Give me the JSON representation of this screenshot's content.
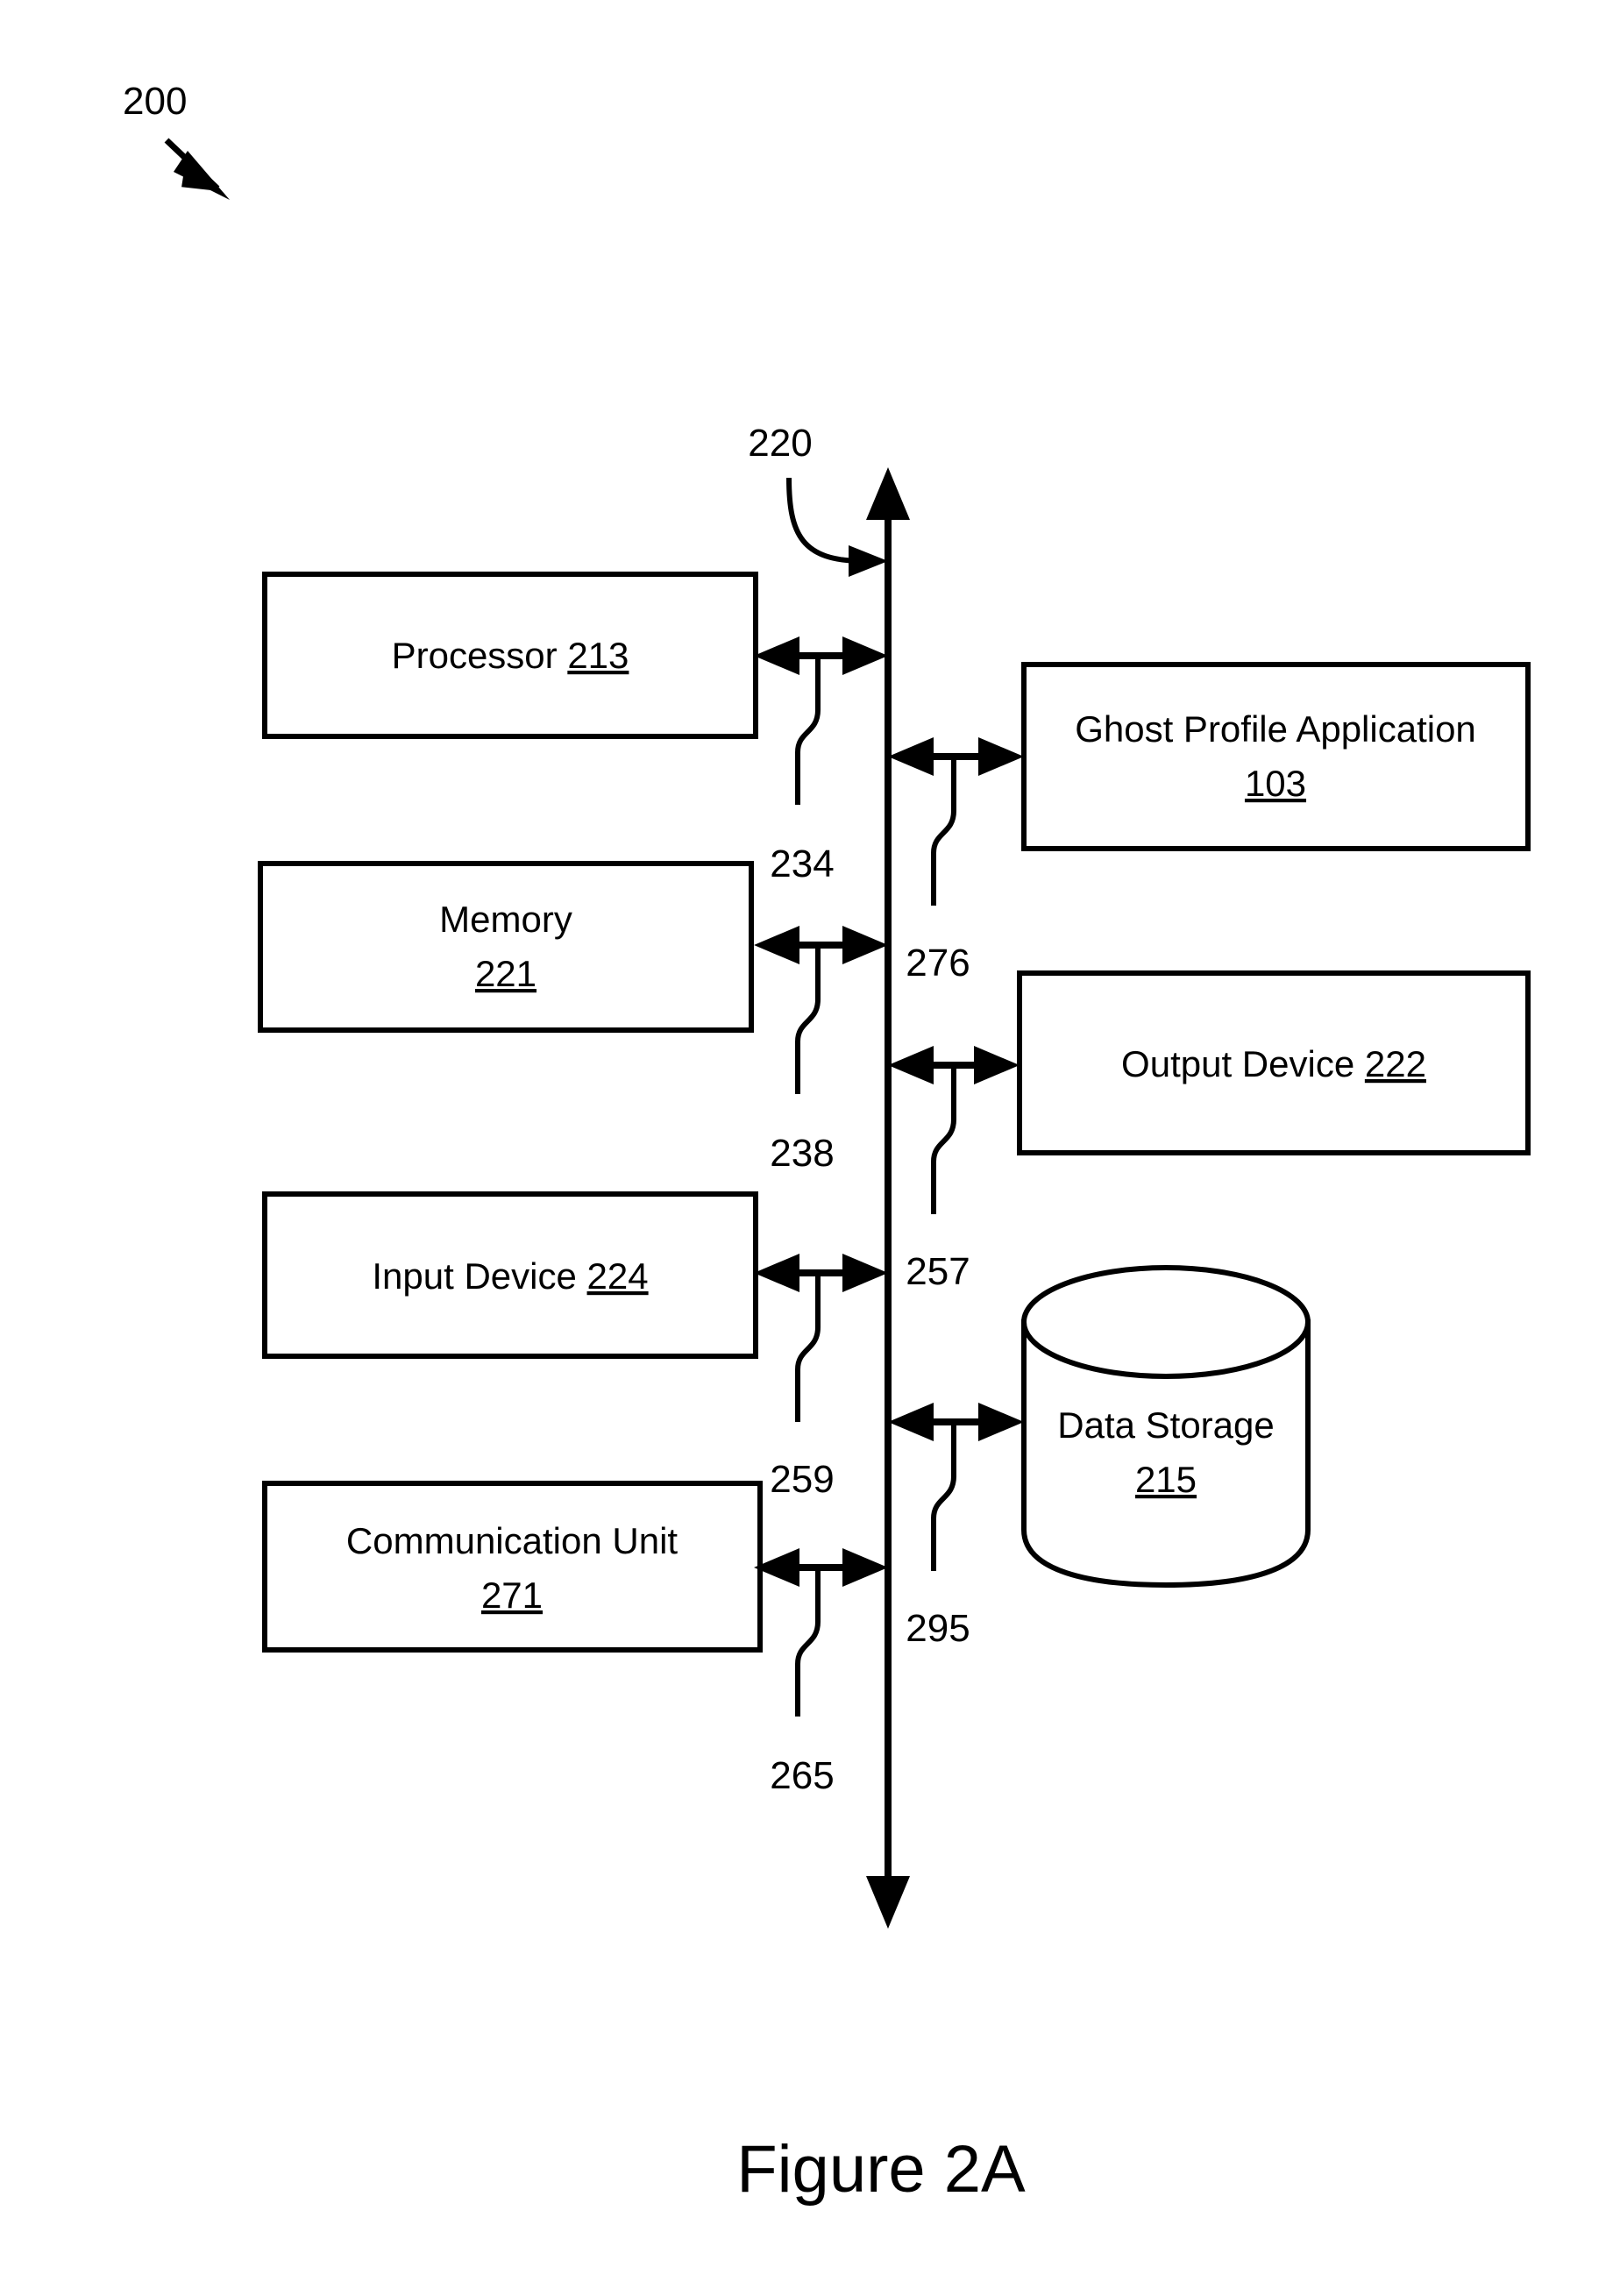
{
  "figure": {
    "caption": "Figure 2A",
    "system_ref": "200",
    "bus_ref": "220"
  },
  "left_blocks": [
    {
      "name": "Processor",
      "ref": "213",
      "layout": "inline",
      "connector_ref": "234"
    },
    {
      "name": "Memory",
      "ref": "221",
      "layout": "stacked",
      "connector_ref": "238"
    },
    {
      "name": "Input Device",
      "ref": "224",
      "layout": "inline",
      "connector_ref": "259"
    },
    {
      "name": "Communication Unit",
      "ref": "271",
      "layout": "stacked",
      "connector_ref": "265"
    }
  ],
  "right_blocks": [
    {
      "name": "Ghost Profile Application",
      "ref": "103",
      "layout": "stacked",
      "shape": "rect",
      "connector_ref": "276"
    },
    {
      "name": "Output Device",
      "ref": "222",
      "layout": "inline",
      "shape": "rect",
      "connector_ref": "257"
    },
    {
      "name": "Data Storage",
      "ref": "215",
      "layout": "stacked",
      "shape": "cylinder",
      "connector_ref": "295"
    }
  ],
  "colors": {
    "stroke": "#000000",
    "fill": "#ffffff",
    "background": "#ffffff"
  }
}
